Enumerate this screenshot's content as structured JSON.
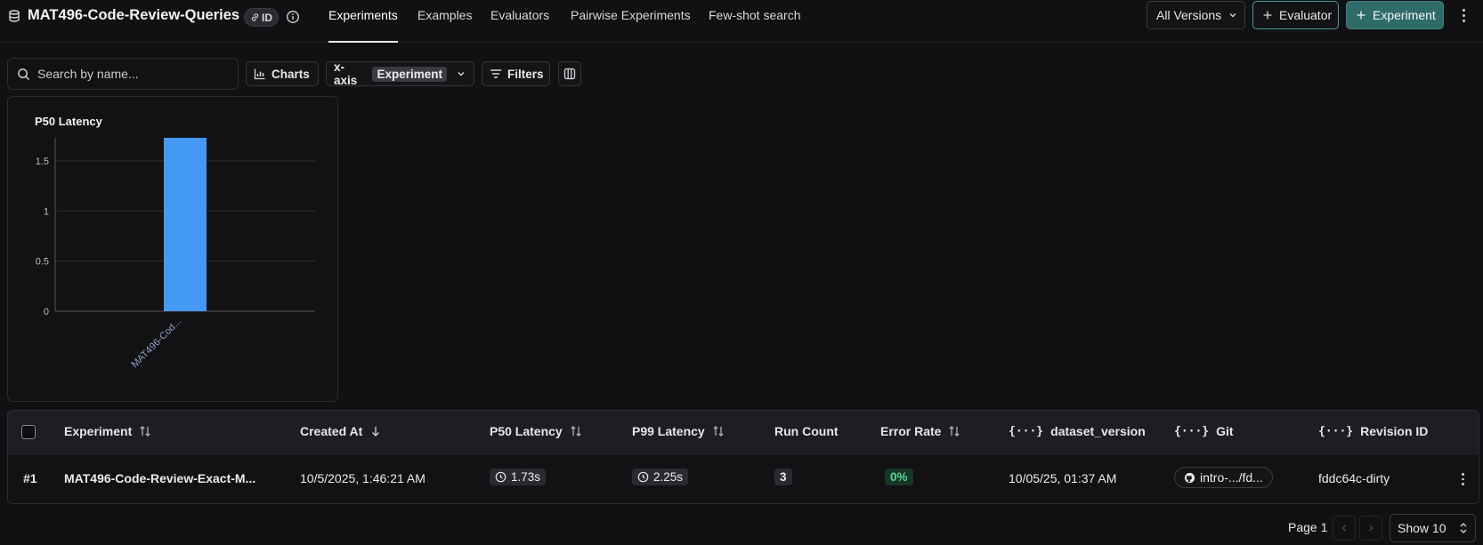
{
  "header": {
    "dataset_title": "MAT496-Code-Review-Queries",
    "id_badge": "ID",
    "tabs": [
      {
        "label": "Experiments"
      },
      {
        "label": "Examples"
      },
      {
        "label": "Evaluators"
      },
      {
        "label": "Pairwise Experiments"
      },
      {
        "label": "Few-shot search"
      }
    ],
    "versions_label": "All Versions",
    "add_evaluator_label": "Evaluator",
    "add_experiment_label": "Experiment"
  },
  "toolbar": {
    "search_placeholder": "Search by name...",
    "charts_label": "Charts",
    "xaxis_label": "x-axis",
    "xaxis_value": "Experiment",
    "filters_label": "Filters"
  },
  "chart_data": {
    "type": "bar",
    "title": "P50 Latency",
    "categories": [
      "MAT496-Cod..."
    ],
    "values": [
      1.73
    ],
    "ylim": [
      0,
      1.73
    ],
    "yticks": [
      "0",
      "0.5",
      "1",
      "1.5"
    ],
    "ytick_values": [
      0,
      0.5,
      1,
      1.5
    ],
    "grid": true,
    "bar_color": "#4499f5"
  },
  "table": {
    "columns": [
      {
        "label": "Experiment"
      },
      {
        "label": "Created At"
      },
      {
        "label": "P50 Latency"
      },
      {
        "label": "P99 Latency"
      },
      {
        "label": "Run Count"
      },
      {
        "label": "Error Rate"
      },
      {
        "label": "dataset_version"
      },
      {
        "label": "Git"
      },
      {
        "label": "Revision ID"
      }
    ],
    "rows": [
      {
        "index": "#1",
        "experiment": "MAT496-Code-Review-Exact-M...",
        "created_at": "10/5/2025, 1:46:21 AM",
        "p50": "1.73s",
        "p99": "2.25s",
        "run_count": "3",
        "error_rate": "0%",
        "dataset_version": "10/05/25, 01:37 AM",
        "git": "intro-.../fd...",
        "revision_id": "fddc64c-dirty"
      }
    ]
  },
  "pagination": {
    "page_label": "Page 1",
    "show_label": "Show 10"
  },
  "colors": {
    "accent": "#2f6b69",
    "bar": "#4499f5",
    "success": "#58d58f"
  }
}
